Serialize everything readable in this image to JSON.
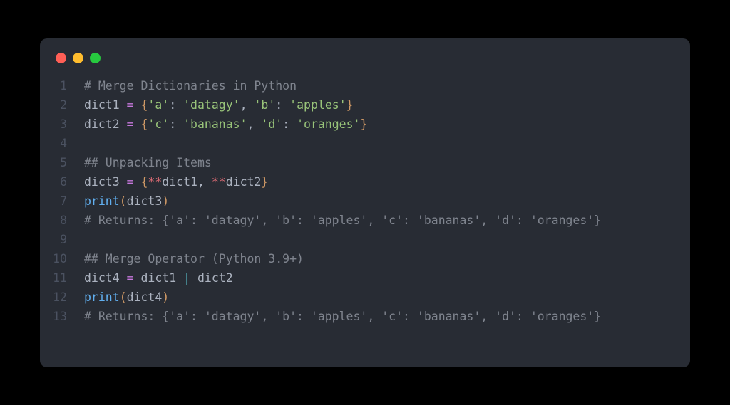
{
  "window": {
    "dots": [
      "close",
      "minimize",
      "zoom"
    ]
  },
  "code": {
    "line_numbers": [
      "1",
      "2",
      "3",
      "4",
      "5",
      "6",
      "7",
      "8",
      "9",
      "10",
      "11",
      "12",
      "13"
    ],
    "lines": [
      [
        [
          "comment",
          "# Merge Dictionaries in Python"
        ]
      ],
      [
        [
          "def",
          "dict1 "
        ],
        [
          "op",
          "="
        ],
        [
          "punc",
          " "
        ],
        [
          "brace",
          "{"
        ],
        [
          "str",
          "'a'"
        ],
        [
          "punc",
          ": "
        ],
        [
          "str",
          "'datagy'"
        ],
        [
          "punc",
          ", "
        ],
        [
          "str",
          "'b'"
        ],
        [
          "punc",
          ": "
        ],
        [
          "str",
          "'apples'"
        ],
        [
          "brace",
          "}"
        ]
      ],
      [
        [
          "def",
          "dict2 "
        ],
        [
          "op",
          "="
        ],
        [
          "punc",
          " "
        ],
        [
          "brace",
          "{"
        ],
        [
          "str",
          "'c'"
        ],
        [
          "punc",
          ": "
        ],
        [
          "str",
          "'bananas'"
        ],
        [
          "punc",
          ", "
        ],
        [
          "str",
          "'d'"
        ],
        [
          "punc",
          ": "
        ],
        [
          "str",
          "'oranges'"
        ],
        [
          "brace",
          "}"
        ]
      ],
      [],
      [
        [
          "comment",
          "## Unpacking Items"
        ]
      ],
      [
        [
          "def",
          "dict3 "
        ],
        [
          "op",
          "="
        ],
        [
          "punc",
          " "
        ],
        [
          "brace",
          "{"
        ],
        [
          "star",
          "**"
        ],
        [
          "def",
          "dict1"
        ],
        [
          "punc",
          ", "
        ],
        [
          "star",
          "**"
        ],
        [
          "def",
          "dict2"
        ],
        [
          "brace",
          "}"
        ]
      ],
      [
        [
          "fn",
          "print"
        ],
        [
          "brace",
          "("
        ],
        [
          "def",
          "dict3"
        ],
        [
          "brace",
          ")"
        ]
      ],
      [
        [
          "comment",
          "# Returns: {'a': 'datagy', 'b': 'apples', 'c': 'bananas', 'd': 'oranges'}"
        ]
      ],
      [],
      [
        [
          "comment",
          "## Merge Operator (Python 3.9+)"
        ]
      ],
      [
        [
          "def",
          "dict4 "
        ],
        [
          "op",
          "="
        ],
        [
          "def",
          " dict1 "
        ],
        [
          "pipe",
          "|"
        ],
        [
          "def",
          " dict2"
        ]
      ],
      [
        [
          "fn",
          "print"
        ],
        [
          "brace",
          "("
        ],
        [
          "def",
          "dict4"
        ],
        [
          "brace",
          ")"
        ]
      ],
      [
        [
          "comment",
          "# Returns: {'a': 'datagy', 'b': 'apples', 'c': 'bananas', 'd': 'oranges'}"
        ]
      ]
    ]
  }
}
